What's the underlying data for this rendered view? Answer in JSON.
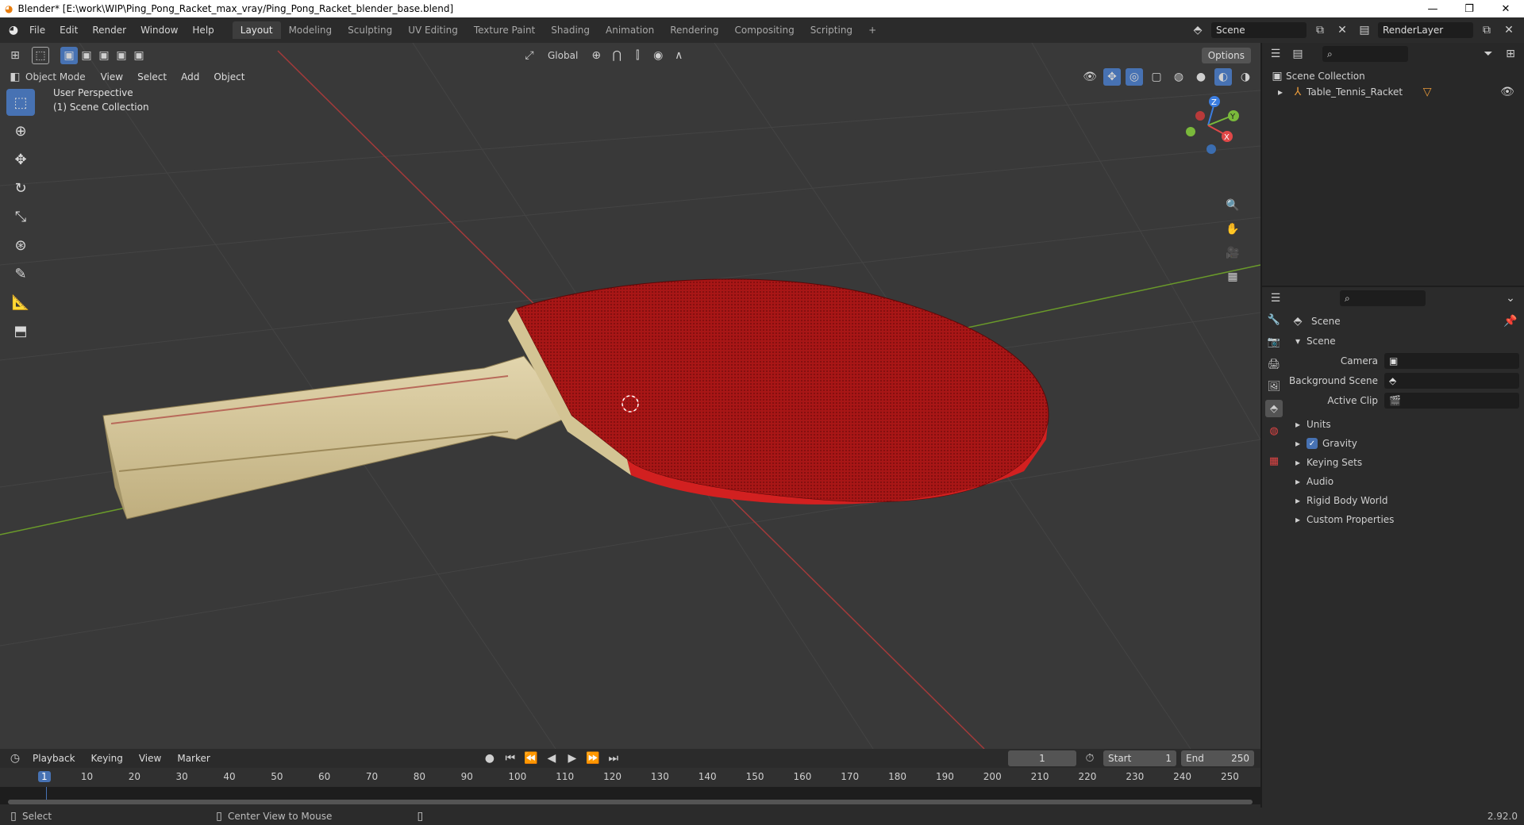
{
  "window": {
    "title": "Blender* [E:\\work\\WIP\\Ping_Pong_Racket_max_vray/Ping_Pong_Racket_blender_base.blend]",
    "controls": [
      "—",
      "❐",
      "✕"
    ]
  },
  "menu": [
    "File",
    "Edit",
    "Render",
    "Window",
    "Help"
  ],
  "workspaces": {
    "tabs": [
      "Layout",
      "Modeling",
      "Sculpting",
      "UV Editing",
      "Texture Paint",
      "Shading",
      "Animation",
      "Rendering",
      "Compositing",
      "Scripting"
    ],
    "active": "Layout",
    "add": "+"
  },
  "scene_selector": {
    "scene": "Scene",
    "view_layer": "RenderLayer"
  },
  "viewport": {
    "mode": "Object Mode",
    "header_menus": [
      "View",
      "Select",
      "Add",
      "Object"
    ],
    "transform_orientation": "Global",
    "options_label": "Options",
    "info_line1": "User Perspective",
    "info_line2": "(1) Scene Collection",
    "gizmo_axes": {
      "x": "X",
      "y": "Y",
      "z": "Z"
    }
  },
  "outliner": {
    "root": "Scene Collection",
    "items": [
      {
        "name": "Table_Tennis_Racket"
      }
    ]
  },
  "properties": {
    "context_title": "Scene",
    "section": "Scene",
    "fields": [
      {
        "label": "Camera",
        "value": ""
      },
      {
        "label": "Background Scene",
        "value": ""
      },
      {
        "label": "Active Clip",
        "value": ""
      }
    ],
    "subpanels": [
      {
        "label": "Units",
        "checkbox": false
      },
      {
        "label": "Gravity",
        "checkbox": true
      },
      {
        "label": "Keying Sets",
        "checkbox": false
      },
      {
        "label": "Audio",
        "checkbox": false
      },
      {
        "label": "Rigid Body World",
        "checkbox": false
      },
      {
        "label": "Custom Properties",
        "checkbox": false
      }
    ]
  },
  "timeline": {
    "menus": [
      "Playback",
      "Keying",
      "View",
      "Marker"
    ],
    "current_frame": "1",
    "start_label": "Start",
    "start": "1",
    "end_label": "End",
    "end": "250",
    "ticks": [
      "1",
      "10",
      "20",
      "30",
      "40",
      "50",
      "60",
      "70",
      "80",
      "90",
      "100",
      "110",
      "120",
      "130",
      "140",
      "150",
      "160",
      "170",
      "180",
      "190",
      "200",
      "210",
      "220",
      "230",
      "240",
      "250"
    ]
  },
  "statusbar": {
    "left": "Select",
    "middle": "Center View to Mouse",
    "version": "2.92.0"
  },
  "colors": {
    "accent": "#4772b3",
    "racket_red": "#b01818",
    "wood": "#d8c9a0"
  }
}
